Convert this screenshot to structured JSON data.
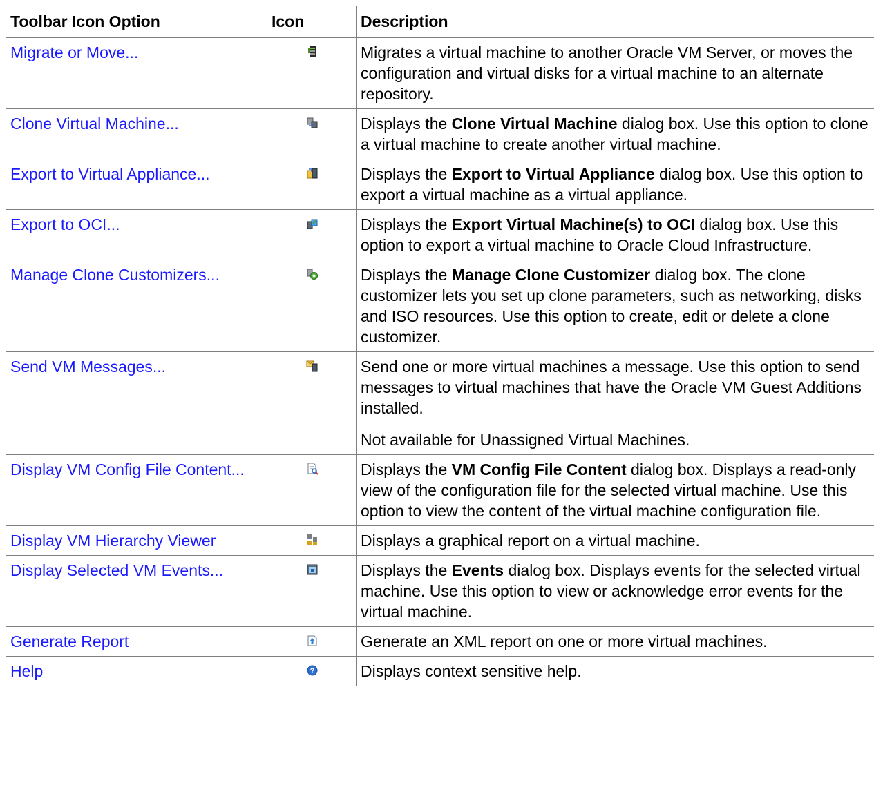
{
  "columns": [
    "Toolbar Icon Option",
    "Icon",
    "Description"
  ],
  "rows": [
    {
      "option": "Migrate or Move...",
      "icon": "migrate-icon",
      "paragraphs": [
        [
          {
            "t": "Migrates a virtual machine to another Oracle VM Server, or moves the configuration and virtual disks for a virtual machine to an alternate repository."
          }
        ]
      ]
    },
    {
      "option": "Clone Virtual Machine...",
      "icon": "clone-icon",
      "paragraphs": [
        [
          {
            "t": "Displays the "
          },
          {
            "t": "Clone Virtual Machine",
            "b": true
          },
          {
            "t": " dialog box. Use this option to clone a virtual machine to create another virtual machine."
          }
        ]
      ]
    },
    {
      "option": "Export to Virtual Appliance...",
      "icon": "export-appliance-icon",
      "paragraphs": [
        [
          {
            "t": "Displays the "
          },
          {
            "t": "Export to Virtual Appliance",
            "b": true
          },
          {
            "t": " dialog box. Use this option to export a virtual machine as a virtual appliance."
          }
        ]
      ]
    },
    {
      "option": "Export to OCI...",
      "icon": "export-oci-icon",
      "paragraphs": [
        [
          {
            "t": "Displays the "
          },
          {
            "t": "Export Virtual Machine(s) to OCI",
            "b": true
          },
          {
            "t": " dialog box. Use this option to export a virtual machine to Oracle Cloud Infrastructure."
          }
        ]
      ]
    },
    {
      "option": "Manage Clone Customizers...",
      "icon": "clone-customizer-icon",
      "paragraphs": [
        [
          {
            "t": "Displays the "
          },
          {
            "t": "Manage Clone Customizer",
            "b": true
          },
          {
            "t": " dialog box. The clone customizer lets you set up clone parameters, such as networking, disks and ISO resources. Use this option to create, edit or delete a clone customizer."
          }
        ]
      ]
    },
    {
      "option": "Send VM Messages...",
      "icon": "send-message-icon",
      "paragraphs": [
        [
          {
            "t": "Send one or more virtual machines a message. Use this option to send messages to virtual machines that have the Oracle VM Guest Additions installed."
          }
        ],
        [
          {
            "t": "Not available for Unassigned Virtual Machines."
          }
        ]
      ]
    },
    {
      "option": "Display VM Config File Content...",
      "icon": "config-file-icon",
      "paragraphs": [
        [
          {
            "t": "Displays the "
          },
          {
            "t": "VM Config File Content",
            "b": true
          },
          {
            "t": " dialog box. Displays a read-only view of the configuration file for the selected virtual machine. Use this option to view the content of the virtual machine configuration file."
          }
        ]
      ]
    },
    {
      "option": "Display VM Hierarchy Viewer",
      "icon": "hierarchy-icon",
      "paragraphs": [
        [
          {
            "t": "Displays a graphical report on a virtual machine."
          }
        ]
      ]
    },
    {
      "option": "Display Selected VM Events...",
      "icon": "events-icon",
      "paragraphs": [
        [
          {
            "t": "Displays the "
          },
          {
            "t": "Events",
            "b": true
          },
          {
            "t": " dialog box. Displays events for the selected virtual machine. Use this option to view or acknowledge error events for the virtual machine."
          }
        ]
      ]
    },
    {
      "option": "Generate Report",
      "icon": "report-icon",
      "paragraphs": [
        [
          {
            "t": "Generate an XML report on one or more virtual machines."
          }
        ]
      ]
    },
    {
      "option": "Help",
      "icon": "help-icon",
      "paragraphs": [
        [
          {
            "t": "Displays context sensitive help."
          }
        ]
      ]
    }
  ]
}
